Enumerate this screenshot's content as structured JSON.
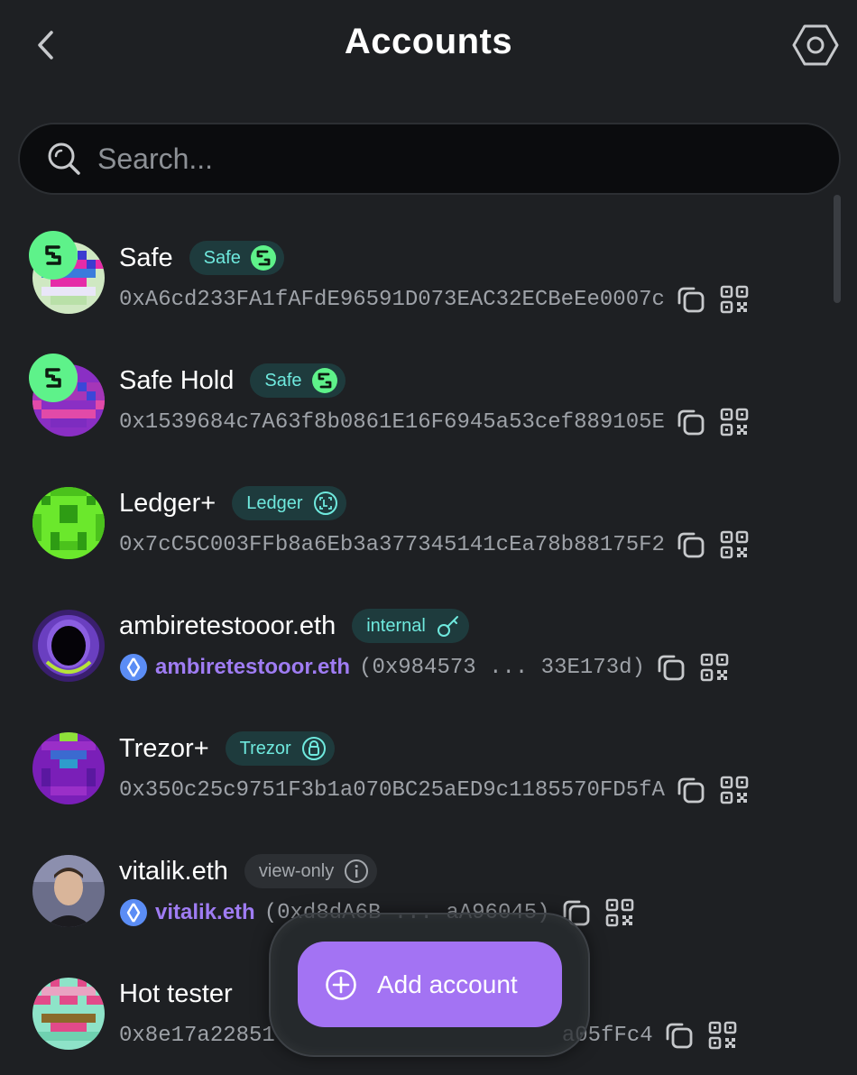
{
  "header": {
    "title": "Accounts"
  },
  "search": {
    "placeholder": "Search..."
  },
  "accounts": [
    {
      "name": "Safe",
      "tag": "Safe",
      "address": "0xA6cd233FA1fAFdE96591D073EAC32ECBeEe0007c"
    },
    {
      "name": "Safe Hold",
      "tag": "Safe",
      "address": "0x1539684c7A63f8b0861E16F6945a53cef889105E"
    },
    {
      "name": "Ledger+",
      "tag": "Ledger",
      "address": "0x7cC5C003FFb8a6Eb3a377345141cEa78b88175F2"
    },
    {
      "name": "ambiretestooor.eth",
      "tag": "internal",
      "ens": "ambiretestooor.eth",
      "address": "(0x984573 ... 33E173d)"
    },
    {
      "name": "Trezor+",
      "tag": "Trezor",
      "address": "0x350c25c9751F3b1a070BC25aED9c1185570FD5fA"
    },
    {
      "name": "vitalik.eth",
      "tag": "view-only",
      "ens": "vitalik.eth",
      "address": "(0xd8dA6B ... aA96045)"
    },
    {
      "name": "Hot tester",
      "address_start": "0x8e17a22851",
      "address_end": "a05fFc4"
    }
  ],
  "add_button": {
    "label": "Add account"
  },
  "colors": {
    "accent": "#a373f3",
    "safe_green": "#5ef28a",
    "tag_text": "#6fe9de",
    "background": "#1e2023"
  }
}
